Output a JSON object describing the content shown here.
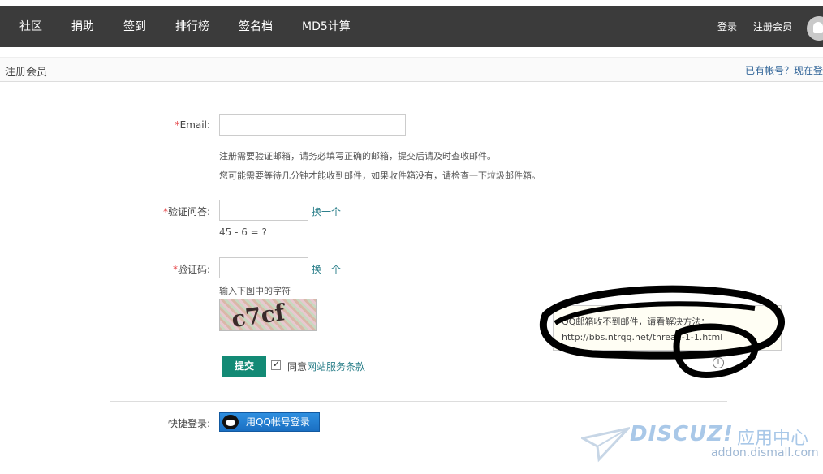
{
  "nav": {
    "items": [
      "社区",
      "捐助",
      "签到",
      "排行榜",
      "签名档",
      "MD5计算"
    ],
    "login": "登录",
    "register": "注册会员"
  },
  "subbar": {
    "title": "注册会员",
    "have_account": "已有帐号？现在登"
  },
  "form": {
    "email_label": "Email:",
    "email_hint_1": "注册需要验证邮箱，请务必填写正确的邮箱，提交后请及时查收邮件。",
    "email_hint_2": "您可能需要等待几分钟才能收到邮件，如果收件箱没有，请检查一下垃圾邮件箱。",
    "question_label": "验证问答:",
    "question_switch": "换一个",
    "question_text": "45 - 6 = ?",
    "captcha_label": "验证码:",
    "captcha_switch": "换一个",
    "captcha_hint": "输入下图中的字符",
    "captcha_chars": "c7cf",
    "required_mark": "*",
    "submit_label": "提交",
    "agree_prefix": "同意",
    "agree_link": "网站服务条款",
    "agree_checked": true
  },
  "tooltip": {
    "line1": "QQ邮箱收不到邮件，请看解决方法：",
    "line2": "http://bbs.ntrqq.net/thread-1-1.html"
  },
  "quick_login": {
    "label": "快捷登录:",
    "qq_button": "用QQ帐号登录"
  },
  "watermark": {
    "brand": "DISCUZ!",
    "cn": "应用中心",
    "url": "addon.dismall.com"
  },
  "colors": {
    "topbar": "#3b3b3b",
    "accent": "#138a75",
    "link": "#2b7f8a",
    "required": "#e4393c"
  }
}
